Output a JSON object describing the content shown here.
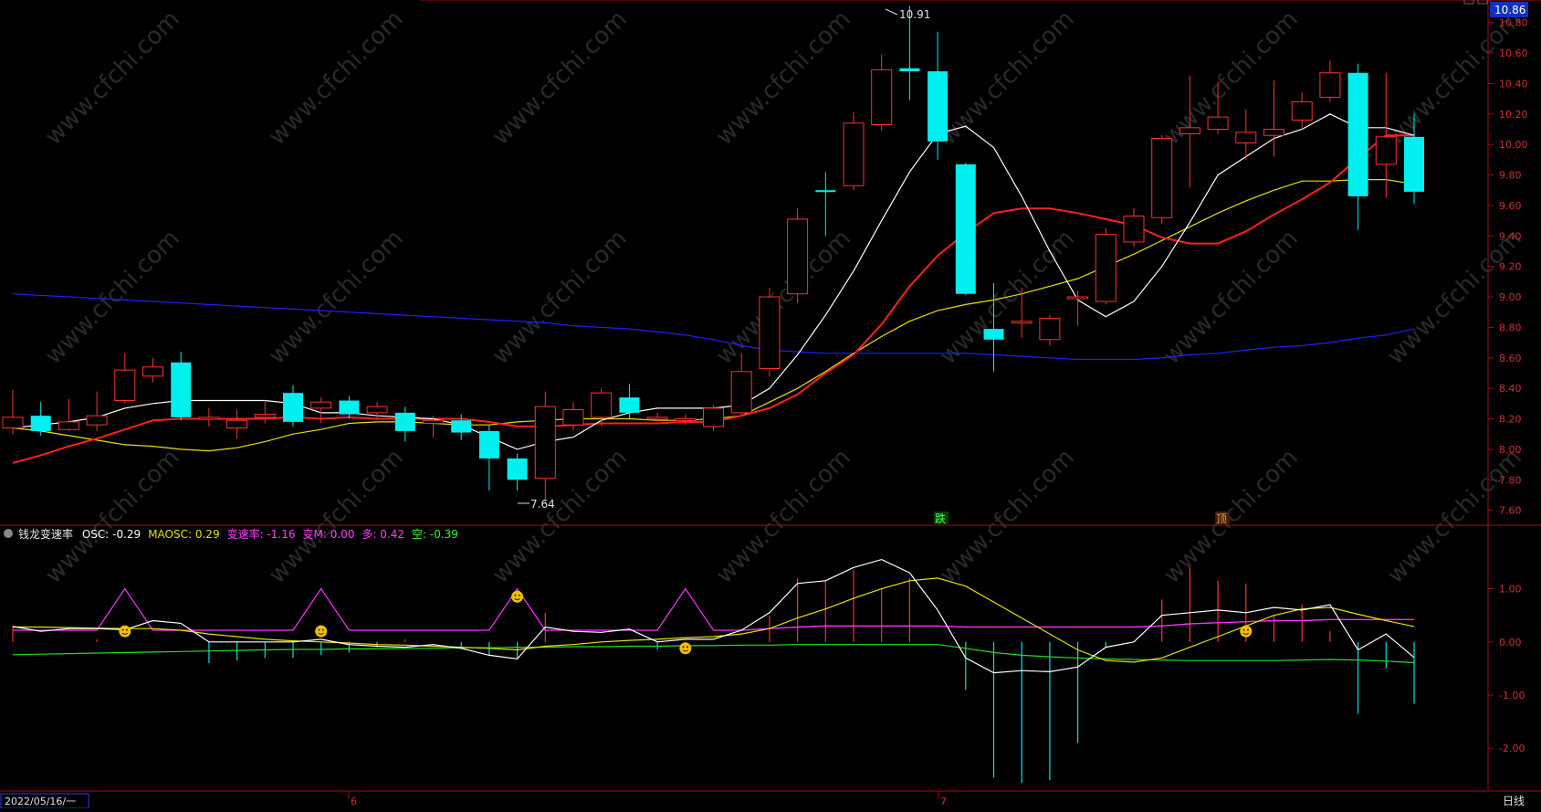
{
  "main_panel": {
    "ma_lines": [
      {
        "name": "MA5",
        "color": "#ffffff"
      },
      {
        "name": "MA10",
        "color": "#ff2020"
      },
      {
        "name": "MA20",
        "color": "#e8e000"
      },
      {
        "name": "MA60",
        "color": "#2020ff"
      }
    ],
    "price_high_label": "10.91",
    "price_low_label": "7.64",
    "current_price_badge": "10.86",
    "signal_labels": [
      "跌",
      "顶"
    ]
  },
  "indicator_panel": {
    "name": "钱龙变速率",
    "fields": [
      {
        "label": "OSC:",
        "value": "-0.29",
        "color": "#ffffff"
      },
      {
        "label": "MAOSC:",
        "value": "0.29",
        "color": "#e8e000"
      },
      {
        "label": "变速率:",
        "value": "-1.16",
        "color": "#ff40ff"
      },
      {
        "label": "变M:",
        "value": "0.00",
        "color": "#ff40ff"
      },
      {
        "label": "多:",
        "value": "0.42",
        "color": "#ff40ff"
      },
      {
        "label": "空:",
        "value": "-0.39",
        "color": "#20ff20"
      }
    ]
  },
  "bottom_bar": {
    "date_box": "2022/05/16/一",
    "month_ticks": [
      "6",
      "7"
    ],
    "period": "日线"
  },
  "watermark": "www.cfchi.com",
  "chart_data": [
    {
      "type": "candlestick",
      "yaxis_ticks": [
        "10.80",
        "10.60",
        "10.40",
        "10.20",
        "10.00",
        "9.80",
        "9.60",
        "9.40",
        "9.20",
        "9.00",
        "8.80",
        "8.60",
        "8.40",
        "8.20",
        "8.00",
        "7.80",
        "7.60"
      ],
      "ylim": [
        7.52,
        10.9
      ],
      "candles": [
        {
          "o": 8.14,
          "c": 8.21,
          "h": 8.39,
          "l": 8.1
        },
        {
          "o": 8.22,
          "c": 8.12,
          "h": 8.31,
          "l": 8.09
        },
        {
          "o": 8.13,
          "c": 8.18,
          "h": 8.33,
          "l": 8.12
        },
        {
          "o": 8.16,
          "c": 8.22,
          "h": 8.38,
          "l": 8.12
        },
        {
          "o": 8.32,
          "c": 8.52,
          "h": 8.63,
          "l": 8.3
        },
        {
          "o": 8.48,
          "c": 8.54,
          "h": 8.6,
          "l": 8.44
        },
        {
          "o": 8.57,
          "c": 8.21,
          "h": 8.64,
          "l": 8.19
        },
        {
          "o": 8.2,
          "c": 8.21,
          "h": 8.27,
          "l": 8.15
        },
        {
          "o": 8.14,
          "c": 8.19,
          "h": 8.26,
          "l": 8.07
        },
        {
          "o": 8.21,
          "c": 8.23,
          "h": 8.32,
          "l": 8.17
        },
        {
          "o": 8.37,
          "c": 8.18,
          "h": 8.42,
          "l": 8.15
        },
        {
          "o": 8.27,
          "c": 8.31,
          "h": 8.34,
          "l": 8.17
        },
        {
          "o": 8.32,
          "c": 8.23,
          "h": 8.35,
          "l": 8.2
        },
        {
          "o": 8.24,
          "c": 8.28,
          "h": 8.31,
          "l": 8.19
        },
        {
          "o": 8.24,
          "c": 8.12,
          "h": 8.28,
          "l": 8.05
        },
        {
          "o": 8.17,
          "c": 8.19,
          "h": 8.22,
          "l": 8.08
        },
        {
          "o": 8.19,
          "c": 8.11,
          "h": 8.23,
          "l": 8.06
        },
        {
          "o": 8.12,
          "c": 7.94,
          "h": 8.16,
          "l": 7.73
        },
        {
          "o": 7.94,
          "c": 7.8,
          "h": 7.97,
          "l": 7.73
        },
        {
          "o": 7.81,
          "c": 8.28,
          "h": 8.38,
          "l": 7.64
        },
        {
          "o": 8.16,
          "c": 8.26,
          "h": 8.31,
          "l": 8.12
        },
        {
          "o": 8.21,
          "c": 8.37,
          "h": 8.4,
          "l": 8.15
        },
        {
          "o": 8.34,
          "c": 8.24,
          "h": 8.43,
          "l": 8.2
        },
        {
          "o": 8.2,
          "c": 8.21,
          "h": 8.24,
          "l": 8.18
        },
        {
          "o": 8.19,
          "c": 8.2,
          "h": 8.23,
          "l": 8.16
        },
        {
          "o": 8.15,
          "c": 8.27,
          "h": 8.29,
          "l": 8.12
        },
        {
          "o": 8.24,
          "c": 8.51,
          "h": 8.63,
          "l": 8.22
        },
        {
          "o": 8.53,
          "c": 9.0,
          "h": 9.06,
          "l": 8.48
        },
        {
          "o": 9.02,
          "c": 9.51,
          "h": 9.58,
          "l": 8.96
        },
        {
          "o": 9.7,
          "c": 9.69,
          "h": 9.82,
          "l": 9.4
        },
        {
          "o": 9.73,
          "c": 10.14,
          "h": 10.21,
          "l": 9.7
        },
        {
          "o": 10.13,
          "c": 10.49,
          "h": 10.59,
          "l": 10.09
        },
        {
          "o": 10.5,
          "c": 10.48,
          "h": 10.91,
          "l": 10.29
        },
        {
          "o": 10.48,
          "c": 10.02,
          "h": 10.74,
          "l": 9.9
        },
        {
          "o": 9.87,
          "c": 9.02,
          "h": 9.88,
          "l": 9.01
        },
        {
          "o": 8.79,
          "c": 8.72,
          "h": 9.09,
          "l": 8.51
        },
        {
          "o": 8.83,
          "c": 8.84,
          "h": 9.06,
          "l": 8.73
        },
        {
          "o": 8.72,
          "c": 8.86,
          "h": 8.88,
          "l": 8.68
        },
        {
          "o": 8.99,
          "c": 9.0,
          "h": 9.04,
          "l": 8.81
        },
        {
          "o": 8.97,
          "c": 9.41,
          "h": 9.45,
          "l": 8.95
        },
        {
          "o": 9.36,
          "c": 9.53,
          "h": 9.58,
          "l": 9.33
        },
        {
          "o": 9.52,
          "c": 10.04,
          "h": 10.06,
          "l": 9.48
        },
        {
          "o": 10.07,
          "c": 10.11,
          "h": 10.45,
          "l": 9.72
        },
        {
          "o": 10.1,
          "c": 10.18,
          "h": 10.41,
          "l": 10.07
        },
        {
          "o": 10.01,
          "c": 10.08,
          "h": 10.23,
          "l": 9.9
        },
        {
          "o": 10.06,
          "c": 10.1,
          "h": 10.42,
          "l": 9.92
        },
        {
          "o": 10.16,
          "c": 10.28,
          "h": 10.34,
          "l": 10.11
        },
        {
          "o": 10.31,
          "c": 10.47,
          "h": 10.55,
          "l": 10.28
        },
        {
          "o": 10.47,
          "c": 9.66,
          "h": 10.53,
          "l": 9.44
        },
        {
          "o": 9.87,
          "c": 10.05,
          "h": 10.47,
          "l": 9.65
        },
        {
          "o": 10.05,
          "c": 9.69,
          "h": 10.2,
          "l": 9.61
        }
      ],
      "ma5": [
        8.14,
        8.16,
        8.18,
        8.21,
        8.27,
        8.3,
        8.32,
        8.32,
        8.32,
        8.32,
        8.3,
        8.24,
        8.24,
        8.22,
        8.21,
        8.2,
        8.16,
        8.08,
        8.0,
        8.05,
        8.08,
        8.19,
        8.24,
        8.27,
        8.27,
        8.27,
        8.29,
        8.4,
        8.62,
        8.88,
        9.17,
        9.5,
        9.82,
        10.07,
        10.12,
        9.98,
        9.66,
        9.3,
        8.98,
        8.87,
        8.97,
        9.2,
        9.49,
        9.8,
        9.92,
        10.04,
        10.1,
        10.2,
        10.11,
        10.11,
        10.06
      ],
      "ma10": [
        7.91,
        7.96,
        8.02,
        8.07,
        8.13,
        8.19,
        8.2,
        8.2,
        8.2,
        8.2,
        8.21,
        8.2,
        8.21,
        8.2,
        8.2,
        8.2,
        8.2,
        8.18,
        8.15,
        8.15,
        8.16,
        8.17,
        8.17,
        8.17,
        8.18,
        8.18,
        8.22,
        8.27,
        8.36,
        8.5,
        8.62,
        8.82,
        9.07,
        9.27,
        9.42,
        9.55,
        9.58,
        9.58,
        9.55,
        9.51,
        9.47,
        9.39,
        9.35,
        9.35,
        9.43,
        9.54,
        9.64,
        9.75,
        9.91,
        10.06,
        10.06
      ],
      "ma20": [
        8.14,
        8.12,
        8.09,
        8.06,
        8.03,
        8.02,
        8.0,
        7.99,
        8.01,
        8.05,
        8.1,
        8.13,
        8.17,
        8.18,
        8.18,
        8.17,
        8.16,
        8.16,
        8.18,
        8.19,
        8.2,
        8.2,
        8.2,
        8.19,
        8.19,
        8.2,
        8.22,
        8.31,
        8.4,
        8.51,
        8.63,
        8.74,
        8.84,
        8.91,
        8.95,
        8.98,
        9.02,
        9.07,
        9.12,
        9.2,
        9.28,
        9.37,
        9.46,
        9.55,
        9.63,
        9.7,
        9.76,
        9.76,
        9.77,
        9.77,
        9.74
      ],
      "ma60": [
        9.02,
        9.01,
        9.0,
        8.99,
        8.98,
        8.97,
        8.96,
        8.95,
        8.94,
        8.93,
        8.92,
        8.91,
        8.9,
        8.89,
        8.88,
        8.87,
        8.86,
        8.85,
        8.84,
        8.83,
        8.81,
        8.8,
        8.79,
        8.77,
        8.75,
        8.72,
        8.68,
        8.65,
        8.64,
        8.63,
        8.63,
        8.63,
        8.63,
        8.63,
        8.63,
        8.62,
        8.61,
        8.6,
        8.59,
        8.59,
        8.59,
        8.6,
        8.62,
        8.63,
        8.65,
        8.67,
        8.68,
        8.7,
        8.73,
        8.75,
        8.79
      ]
    },
    {
      "type": "line",
      "title": "钱龙变速率",
      "yaxis_ticks": [
        "1.00",
        "0.00",
        "-1.00",
        "-2.00"
      ],
      "ylim": [
        -2.7,
        1.8
      ],
      "osc": [
        0.29,
        0.2,
        0.25,
        0.25,
        0.23,
        0.4,
        0.35,
        0.0,
        0.0,
        0.0,
        0.0,
        0.05,
        -0.05,
        -0.08,
        -0.1,
        -0.05,
        -0.12,
        -0.25,
        -0.32,
        0.28,
        0.2,
        0.18,
        0.24,
        0.0,
        0.05,
        0.05,
        0.22,
        0.55,
        1.1,
        1.15,
        1.4,
        1.55,
        1.3,
        0.6,
        -0.3,
        -0.58,
        -0.54,
        -0.56,
        -0.47,
        -0.1,
        0.0,
        0.5,
        0.55,
        0.6,
        0.55,
        0.65,
        0.6,
        0.7,
        -0.15,
        0.15,
        -0.29
      ],
      "maosc": [
        0.28,
        0.28,
        0.27,
        0.26,
        0.25,
        0.25,
        0.22,
        0.15,
        0.1,
        0.05,
        0.02,
        0.0,
        -0.02,
        -0.05,
        -0.06,
        -0.08,
        -0.1,
        -0.12,
        -0.15,
        -0.08,
        -0.05,
        0.0,
        0.03,
        0.05,
        0.08,
        0.1,
        0.15,
        0.25,
        0.45,
        0.62,
        0.82,
        1.0,
        1.15,
        1.2,
        1.05,
        0.75,
        0.45,
        0.15,
        -0.15,
        -0.35,
        -0.38,
        -0.3,
        -0.1,
        0.1,
        0.3,
        0.5,
        0.62,
        0.65,
        0.52,
        0.4,
        0.29
      ],
      "rate": [
        0.3,
        0.0,
        0.0,
        0.05,
        0.0,
        0.0,
        0.0,
        -0.4,
        -0.35,
        -0.3,
        -0.3,
        -0.25,
        -0.2,
        -0.1,
        0.05,
        0.0,
        -0.1,
        -0.25,
        -0.3,
        0.55,
        0.0,
        0.0,
        0.0,
        -0.15,
        0.0,
        0.0,
        0.0,
        0.5,
        1.2,
        1.15,
        1.35,
        1.0,
        1.2,
        0.0,
        -0.9,
        -2.55,
        -2.65,
        -2.6,
        -1.9,
        -0.1,
        0.0,
        0.8,
        1.4,
        1.15,
        1.1,
        0.5,
        0.7,
        0.2,
        -1.35,
        -0.5,
        -1.16
      ],
      "duo": [
        0.22,
        0.22,
        0.22,
        0.22,
        0.22,
        0.22,
        0.22,
        0.22,
        0.22,
        0.22,
        0.22,
        0.22,
        0.22,
        0.22,
        0.22,
        0.22,
        0.22,
        0.22,
        0.22,
        0.22,
        0.22,
        0.22,
        0.22,
        0.22,
        0.22,
        0.22,
        0.22,
        0.25,
        0.28,
        0.3,
        0.3,
        0.3,
        0.3,
        0.3,
        0.28,
        0.28,
        0.28,
        0.28,
        0.28,
        0.28,
        0.28,
        0.3,
        0.34,
        0.36,
        0.38,
        0.4,
        0.4,
        0.42,
        0.42,
        0.42,
        0.42
      ],
      "kong": [
        -0.24,
        -0.23,
        -0.22,
        -0.21,
        -0.2,
        -0.19,
        -0.18,
        -0.17,
        -0.16,
        -0.15,
        -0.14,
        -0.14,
        -0.13,
        -0.13,
        -0.12,
        -0.12,
        -0.11,
        -0.11,
        -0.1,
        -0.1,
        -0.09,
        -0.09,
        -0.08,
        -0.08,
        -0.07,
        -0.07,
        -0.06,
        -0.06,
        -0.05,
        -0.05,
        -0.05,
        -0.05,
        -0.05,
        -0.05,
        -0.12,
        -0.2,
        -0.25,
        -0.28,
        -0.3,
        -0.32,
        -0.33,
        -0.34,
        -0.35,
        -0.35,
        -0.35,
        -0.35,
        -0.34,
        -0.33,
        -0.34,
        -0.36,
        -0.39
      ],
      "bianM_peaks": [
        4,
        11,
        18,
        24
      ],
      "smiley_days": [
        4,
        11,
        18,
        24,
        44
      ]
    }
  ]
}
